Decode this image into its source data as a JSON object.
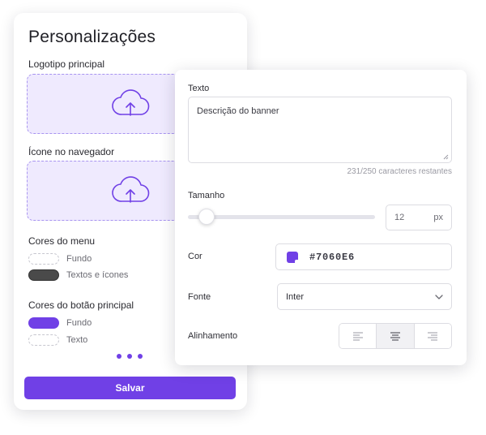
{
  "left_panel": {
    "title": "Personalizações",
    "logo_label": "Logotipo principal",
    "favicon_label": "Ícone no navegador",
    "menu_colors": {
      "label": "Cores do menu",
      "items": [
        {
          "label": "Fundo",
          "swatch": "empty"
        },
        {
          "label": "Textos e ícones",
          "swatch": "#4A4A4A"
        }
      ]
    },
    "button_colors": {
      "label": "Cores do botão principal",
      "items": [
        {
          "label": "Fundo",
          "swatch": "#7040E6"
        },
        {
          "label": "Texto",
          "swatch": "empty"
        }
      ]
    },
    "save_label": "Salvar",
    "icons": {
      "upload": "cloud-upload-icon",
      "more": "more-dots-icon"
    }
  },
  "right_panel": {
    "text_label": "Texto",
    "text_value": "Descrição do banner",
    "char_counter": "231/250 caracteres restantes",
    "size_label": "Tamanho",
    "size_slider": 0.1,
    "size_value": "12",
    "size_unit": "px",
    "color_label": "Cor",
    "color_value": "#7060E6",
    "font_label": "Fonte",
    "font_value": "Inter",
    "align_label": "Alinhamento",
    "align_active": "center",
    "icons": {
      "chevron": "chevron-down-icon",
      "align": [
        "align-left-icon",
        "align-center-icon",
        "align-right-icon"
      ]
    }
  },
  "colors": {
    "accent": "#7040E6",
    "upload_bg": "#EFEAFE",
    "upload_border": "#A894F0"
  }
}
